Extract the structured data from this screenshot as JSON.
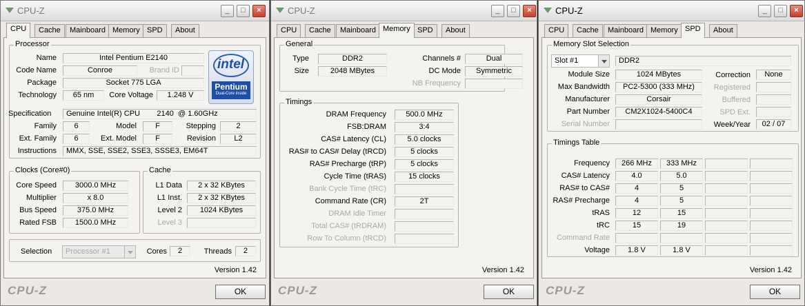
{
  "win1": {
    "title": "CPU-Z",
    "tabs": [
      "CPU",
      "Cache",
      "Mainboard",
      "Memory",
      "SPD",
      "About"
    ],
    "processor": {
      "group": "Processor",
      "name_l": "Name",
      "name": "Intel Pentium E2140",
      "codename_l": "Code Name",
      "codename": "Conroe",
      "brandid_l": "Brand ID",
      "package_l": "Package",
      "package": "Socket 775 LGA",
      "tech_l": "Technology",
      "tech": "65 nm",
      "cv_l": "Core Voltage",
      "cv": "1.248 V",
      "spec_l": "Specification",
      "spec": "Genuine Intel(R) CPU        2140  @ 1.60GHz",
      "family_l": "Family",
      "family": "6",
      "model_l": "Model",
      "model": "F",
      "stepping_l": "Stepping",
      "stepping": "2",
      "extfam_l": "Ext. Family",
      "extfam": "6",
      "extmod_l": "Ext. Model",
      "extmod": "F",
      "rev_l": "Revision",
      "rev": "L2",
      "instr_l": "Instructions",
      "instr": "MMX, SSE, SSE2, SSE3, SSSE3, EM64T",
      "logo_word": "intel",
      "logo_brand": "Pentium",
      "logo_sub": "Dual-Core inside"
    },
    "clocks": {
      "group": "Clocks (Core#0)",
      "core_l": "Core Speed",
      "core": "3000.0 MHz",
      "mult_l": "Multiplier",
      "mult": "x 8.0",
      "bus_l": "Bus Speed",
      "bus": "375.0 MHz",
      "fsb_l": "Rated FSB",
      "fsb": "1500.0 MHz"
    },
    "cache": {
      "group": "Cache",
      "l1d_l": "L1 Data",
      "l1d": "2 x 32 KBytes",
      "l1i_l": "L1 Inst.",
      "l1i": "2 x 32 KBytes",
      "l2_l": "Level 2",
      "l2": "1024 KBytes",
      "l3_l": "Level 3"
    },
    "selection_l": "Selection",
    "selection": "Processor #1",
    "cores_l": "Cores",
    "cores": "2",
    "threads_l": "Threads",
    "threads": "2",
    "version": "Version 1.42",
    "brand": "CPU-Z",
    "ok": "OK"
  },
  "win2": {
    "title": "CPU-Z",
    "tabs": [
      "CPU",
      "Cache",
      "Mainboard",
      "Memory",
      "SPD",
      "About"
    ],
    "general": {
      "group": "General",
      "type_l": "Type",
      "type": "DDR2",
      "size_l": "Size",
      "size": "2048 MBytes",
      "ch_l": "Channels #",
      "ch": "Dual",
      "dc_l": "DC Mode",
      "dc": "Symmetric",
      "nb_l": "NB Frequency"
    },
    "timings": {
      "group": "Timings",
      "rows": [
        {
          "label": "DRAM Frequency",
          "value": "500.0 MHz"
        },
        {
          "label": "FSB:DRAM",
          "value": "3:4"
        },
        {
          "label": "CAS# Latency (CL)",
          "value": "5.0 clocks"
        },
        {
          "label": "RAS# to CAS# Delay (tRCD)",
          "value": "5 clocks"
        },
        {
          "label": "RAS# Precharge (tRP)",
          "value": "5 clocks"
        },
        {
          "label": "Cycle Time (tRAS)",
          "value": "15 clocks"
        },
        {
          "label": "Bank Cycle Time (tRC)",
          "value": ""
        },
        {
          "label": "Command Rate (CR)",
          "value": "2T"
        },
        {
          "label": "DRAM Idle Timer",
          "value": ""
        },
        {
          "label": "Total CAS# (tRDRAM)",
          "value": ""
        },
        {
          "label": "Row To Column (tRCD)",
          "value": ""
        }
      ]
    },
    "version": "Version 1.42",
    "brand": "CPU-Z",
    "ok": "OK"
  },
  "win3": {
    "title": "CPU-Z",
    "tabs": [
      "CPU",
      "Cache",
      "Mainboard",
      "Memory",
      "SPD",
      "About"
    ],
    "slot": {
      "group": "Memory Slot Selection",
      "slot": "Slot #1",
      "type": "DDR2",
      "modsize_l": "Module Size",
      "modsize": "1024 MBytes",
      "maxbw_l": "Max Bandwidth",
      "maxbw": "PC2-5300 (333 MHz)",
      "mfr_l": "Manufacturer",
      "mfr": "Corsair",
      "pn_l": "Part Number",
      "pn": "CM2X1024-5400C4",
      "sn_l": "Serial Number",
      "corr_l": "Correction",
      "corr": "None",
      "reg_l": "Registered",
      "buf_l": "Buffered",
      "spdext_l": "SPD Ext.",
      "wy_l": "Week/Year",
      "wy": "02 / 07"
    },
    "tt": {
      "group": "Timings Table",
      "labels": [
        "Frequency",
        "CAS# Latency",
        "RAS# to CAS#",
        "RAS# Precharge",
        "tRAS",
        "tRC",
        "Command Rate",
        "Voltage"
      ],
      "col1": [
        "266 MHz",
        "4.0",
        "4",
        "4",
        "12",
        "15",
        "",
        "1.8 V"
      ],
      "col2": [
        "333 MHz",
        "5.0",
        "5",
        "5",
        "15",
        "19",
        "",
        "1.8 V"
      ]
    },
    "version": "Version 1.42",
    "brand": "CPU-Z",
    "ok": "OK"
  }
}
